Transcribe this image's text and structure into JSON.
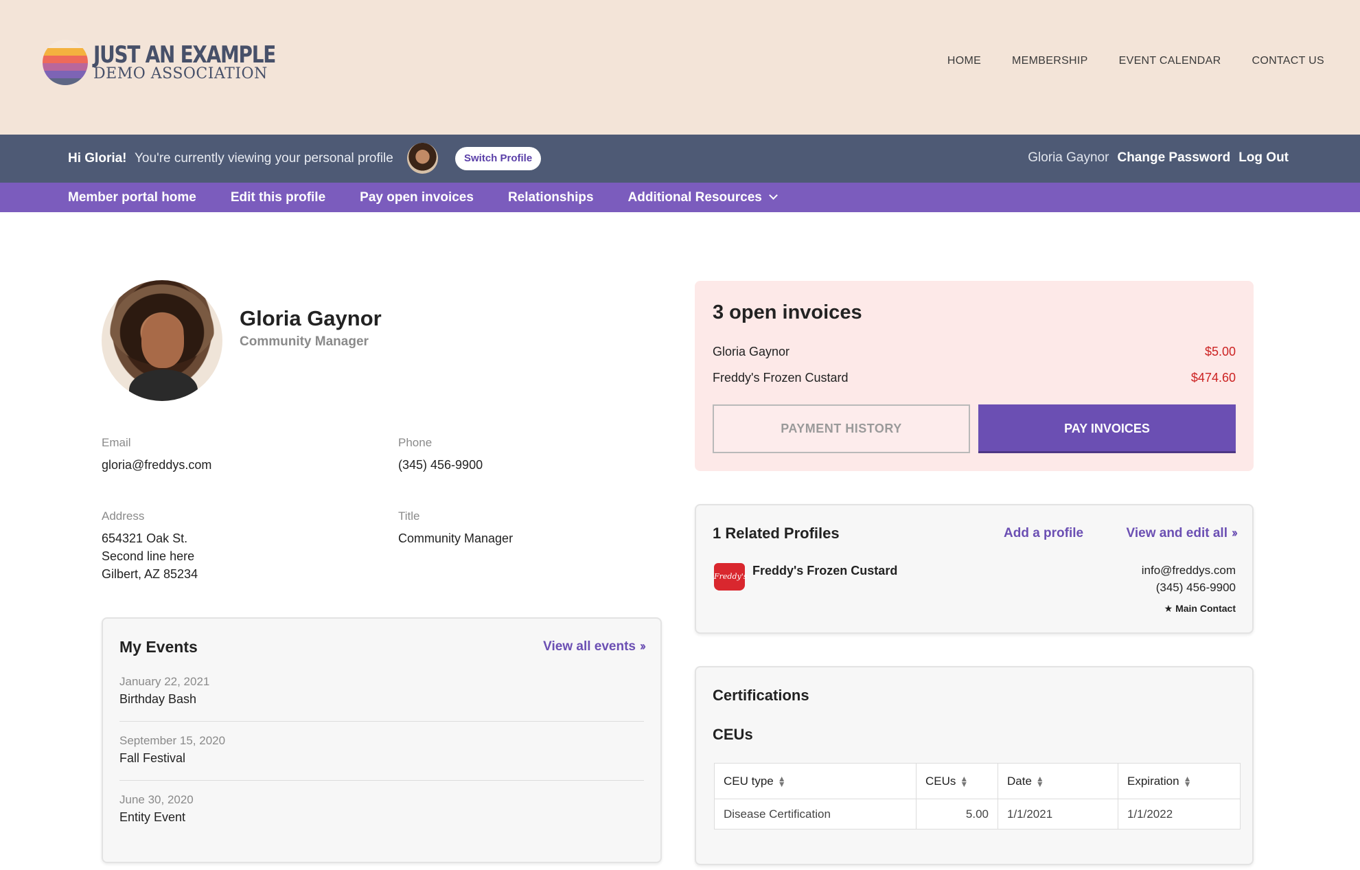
{
  "brand": {
    "line1": "JUST AN EXAMPLE",
    "line2": "DEMO ASSOCIATION"
  },
  "top_nav": [
    "HOME",
    "MEMBERSHIP",
    "EVENT CALENDAR",
    "CONTACT US"
  ],
  "account_bar": {
    "greeting": "Hi Gloria!",
    "viewing_text": "You're currently viewing your personal profile",
    "switch_label": "Switch Profile",
    "user_name": "Gloria Gaynor",
    "change_password": "Change Password",
    "logout": "Log Out"
  },
  "sub_nav": [
    "Member portal home",
    "Edit this profile",
    "Pay open invoices",
    "Relationships",
    "Additional Resources"
  ],
  "profile": {
    "name": "Gloria Gaynor",
    "title": "Community Manager",
    "email_label": "Email",
    "email": "gloria@freddys.com",
    "phone_label": "Phone",
    "phone": "(345) 456-9900",
    "address_label": "Address",
    "address_line1": "654321 Oak St.",
    "address_line2": "Second line here",
    "address_line3": "Gilbert, AZ 85234",
    "title_label": "Title",
    "title_value": "Community Manager"
  },
  "events": {
    "heading": "My Events",
    "view_all": "View all events",
    "items": [
      {
        "date": "January 22, 2021",
        "name": "Birthday Bash"
      },
      {
        "date": "September 15, 2020",
        "name": "Fall Festival"
      },
      {
        "date": "June 30, 2020",
        "name": "Entity Event"
      }
    ]
  },
  "invoices": {
    "heading": "3 open invoices",
    "rows": [
      {
        "name": "Gloria Gaynor",
        "amount": "$5.00"
      },
      {
        "name": "Freddy's Frozen Custard",
        "amount": "$474.60"
      }
    ],
    "history_label": "PAYMENT HISTORY",
    "pay_label": "PAY INVOICES",
    "amount_color": "#cc2222"
  },
  "related": {
    "heading": "1 Related Profiles",
    "add_label": "Add a profile",
    "view_edit_label": "View and edit all",
    "org_name": "Freddy's Frozen Custard",
    "org_logo_text": "Freddy's",
    "org_email": "info@freddys.com",
    "org_phone": "(345) 456-9900",
    "main_contact": "★ Main Contact"
  },
  "certifications": {
    "heading": "Certifications",
    "subheading": "CEUs",
    "columns": [
      "CEU type",
      "CEUs",
      "Date",
      "Expiration"
    ],
    "rows": [
      {
        "type": "Disease Certification",
        "ceus": "5.00",
        "date": "1/1/2021",
        "expiration": "1/1/2022"
      }
    ]
  },
  "colors": {
    "header_bg": "#f3e4d8",
    "account_bar_bg": "#4e5a75",
    "nav_purple": "#7b5cbd",
    "button_purple": "#6b4fb3",
    "invoice_bg": "#fde9e8"
  }
}
